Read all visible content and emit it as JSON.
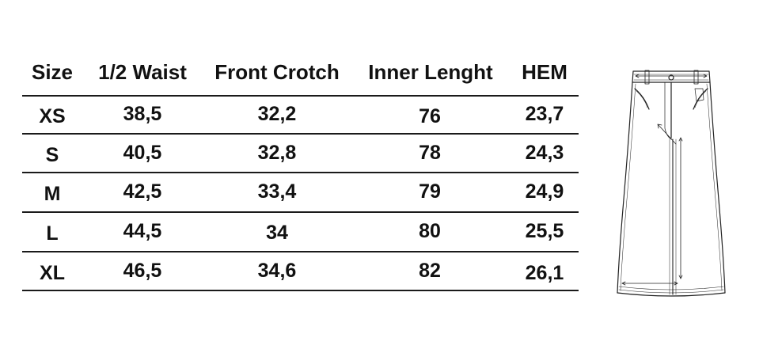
{
  "table": {
    "headers": [
      "Size",
      "1/2 Waist",
      "Front Crotch",
      "Inner Lenght",
      "HEM"
    ],
    "rows": [
      [
        "XS",
        "38,5",
        "32,2",
        "76",
        "23,7"
      ],
      [
        "S",
        "40,5",
        "32,8",
        "78",
        "24,3"
      ],
      [
        "M",
        "42,5",
        "33,4",
        "79",
        "24,9"
      ],
      [
        "L",
        "44,5",
        "34",
        "80",
        "25,5"
      ],
      [
        "XL",
        "46,5",
        "34,6",
        "82",
        "26,1"
      ]
    ]
  },
  "colors": {
    "text": "#111111",
    "rule": "#1a1a1a",
    "background": "#ffffff"
  },
  "illustration_icon": "denim-skirt-measurement-icon"
}
